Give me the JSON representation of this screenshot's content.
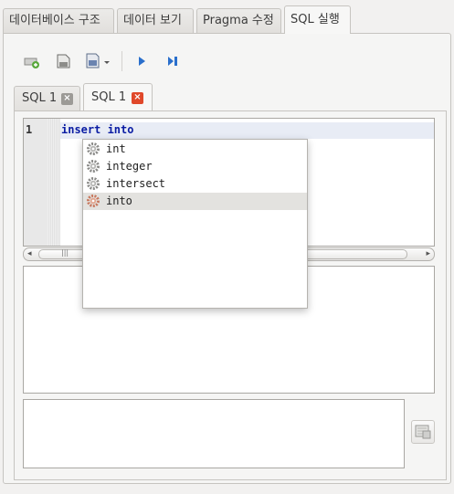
{
  "main_tabs": [
    "데이터베이스 구조",
    "데이터 보기",
    "Pragma 수정",
    "SQL 실행"
  ],
  "toolbar": {
    "icons": [
      "open-tab-icon",
      "open-sql-icon",
      "save-sql-icon",
      "dropdown-arrow-icon",
      "execute-all-icon",
      "execute-current-line-icon"
    ]
  },
  "sql_tabs": [
    {
      "label": "SQL 1",
      "close": "×"
    },
    {
      "label": "SQL 1",
      "close": "×"
    }
  ],
  "editor": {
    "line_number": "1",
    "code": "insert into"
  },
  "autocomplete": {
    "items": [
      "int",
      "integer",
      "intersect",
      "into"
    ],
    "selected": "into"
  },
  "scrollbar": {
    "left_arrow": "◂",
    "right_arrow": "▸",
    "grip": "|||"
  },
  "colors": {
    "keyword": "#0a1ca3",
    "close_active": "#e0482a",
    "close_inactive": "#9c9a96"
  }
}
